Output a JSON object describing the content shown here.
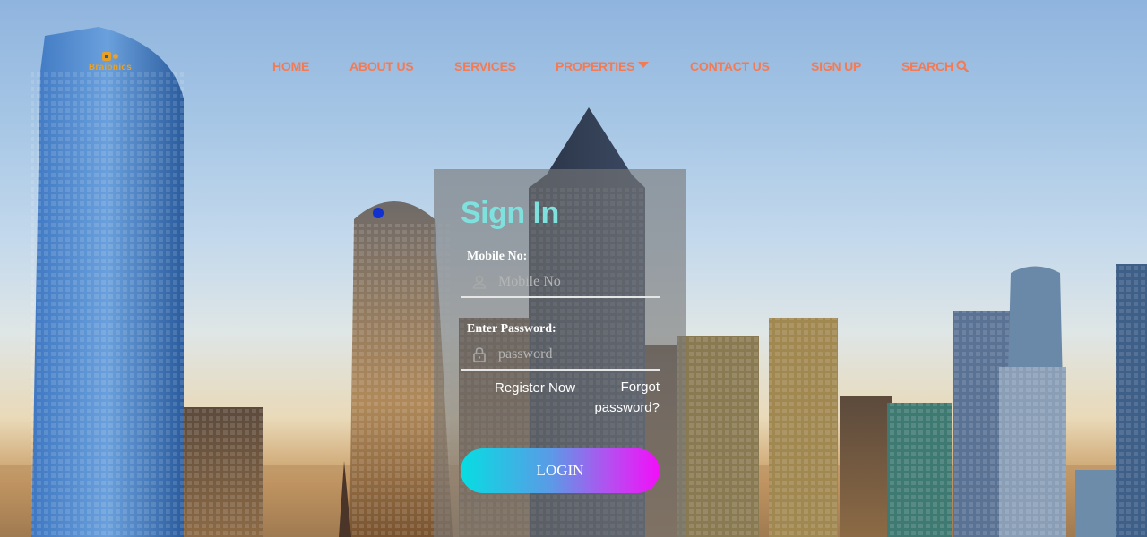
{
  "brand": {
    "name": "Braionics",
    "tagline": "",
    "color": "#e8a126"
  },
  "nav": {
    "color": "#f47a53",
    "items": [
      {
        "label": "HOME"
      },
      {
        "label": "ABOUT US"
      },
      {
        "label": "SERVICES"
      },
      {
        "label": "PROPERTIES",
        "icon": "caret-down-icon"
      },
      {
        "label": "CONTACT US"
      },
      {
        "label": "SIGN UP"
      },
      {
        "label": "SEARCH",
        "icon": "search-icon"
      }
    ]
  },
  "signin": {
    "title": "Sign In",
    "title_color": "#7fe1de",
    "mobile": {
      "label": "Mobile No:",
      "placeholder": "Mobile No",
      "value": "",
      "icon": "user-icon"
    },
    "password": {
      "label": "Enter Password:",
      "placeholder": "password",
      "value": "",
      "icon": "lock-icon"
    },
    "register_link": "Register Now",
    "forgot_link": "Forgot password?",
    "login_button": "LOGIN",
    "button_gradient": [
      "#06dde2",
      "#f20ff9"
    ]
  }
}
